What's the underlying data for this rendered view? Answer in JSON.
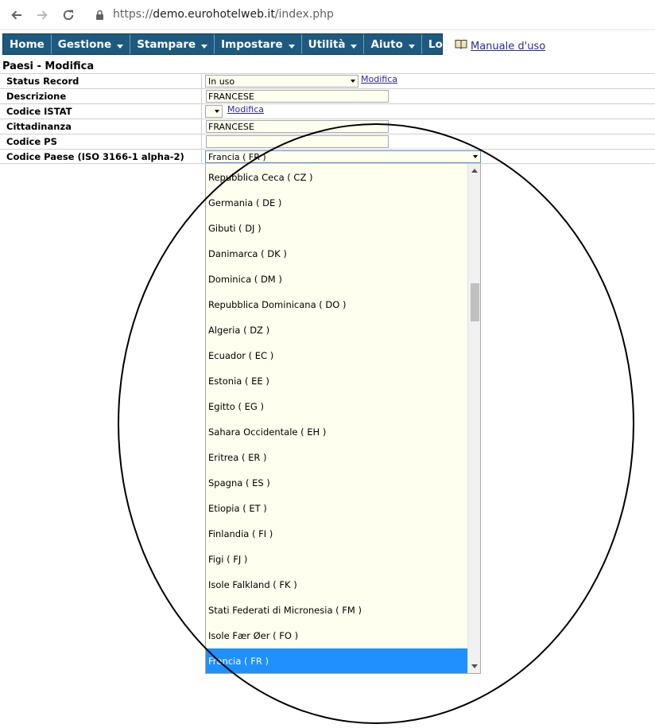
{
  "browser": {
    "url_protocol": "https://",
    "url_host": "demo.eurohotelweb.it",
    "url_path": "/index.php"
  },
  "menu": {
    "items": [
      {
        "label": "Home",
        "dropdown": false
      },
      {
        "label": "Gestione",
        "dropdown": true
      },
      {
        "label": "Stampare",
        "dropdown": true
      },
      {
        "label": "Impostare",
        "dropdown": true
      },
      {
        "label": "Utilità",
        "dropdown": true
      },
      {
        "label": "Aiuto",
        "dropdown": true
      },
      {
        "label": "Logout",
        "dropdown": false
      }
    ],
    "manual_link": "Manuale d'uso"
  },
  "page": {
    "title": "Paesi - Modifica"
  },
  "form": {
    "status_record": {
      "label": "Status Record",
      "value": "In uso",
      "link": "Modifica"
    },
    "descrizione": {
      "label": "Descrizione",
      "value": "FRANCESE"
    },
    "codice_istat": {
      "label": "Codice ISTAT",
      "value": "",
      "link": "Modifica"
    },
    "cittadinanza": {
      "label": "Cittadinanza",
      "value": "FRANCESE"
    },
    "codice_ps": {
      "label": "Codice PS",
      "value": ""
    },
    "codice_paese": {
      "label": "Codice Paese (ISO 3166-1 alpha-2)",
      "value": "Francia ( FR )"
    }
  },
  "dropdown": {
    "options": [
      "Repubblica Ceca ( CZ )",
      "Germania ( DE )",
      "Gibuti ( DJ )",
      "Danimarca ( DK )",
      "Dominica ( DM )",
      "Repubblica Dominicana ( DO )",
      "Algeria ( DZ )",
      "Ecuador ( EC )",
      "Estonia ( EE )",
      "Egitto ( EG )",
      "Sahara Occidentale ( EH )",
      "Eritrea ( ER )",
      "Spagna ( ES )",
      "Etiopia ( ET )",
      "Finlandia ( FI )",
      "Figi ( FJ )",
      "Isole Falkland ( FK )",
      "Stati Federati di Micronesia ( FM )",
      "Isole Fær Øer ( FO )",
      "Francia ( FR )"
    ],
    "selected": "Francia ( FR )"
  },
  "colors": {
    "menu_bg": "#1e5a80",
    "input_bg": "#fffff0",
    "selected_option_bg": "#1e90ff",
    "link": "#2a2aa0"
  },
  "icons": {
    "back": "arrow-left-icon",
    "forward": "arrow-right-icon",
    "reload": "reload-icon",
    "secure": "lock-icon",
    "manual": "book-icon"
  }
}
